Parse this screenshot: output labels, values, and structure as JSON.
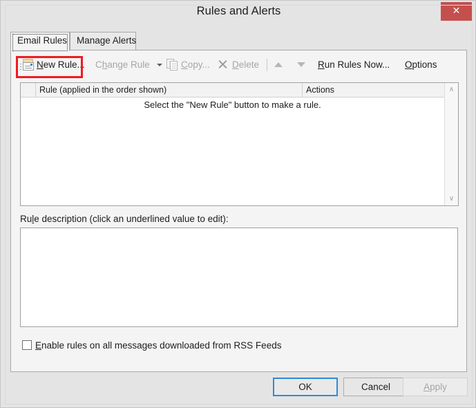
{
  "window": {
    "title": "Rules and Alerts",
    "close_icon": "close-icon",
    "close_glyph": "✕",
    "accent_close_bg": "#c4504e"
  },
  "tabs": [
    {
      "label": "Email Rules",
      "active": true
    },
    {
      "label": "Manage Alerts",
      "active": false
    }
  ],
  "toolbar": {
    "new_rule": {
      "label_pre": "",
      "accel": "N",
      "label_post": "ew Rule...",
      "icon": "new-rule-icon",
      "enabled": true,
      "highlight_color": "#ed1c24"
    },
    "change_rule": {
      "label_pre": "C",
      "accel": "h",
      "label_post": "ange Rule",
      "icon": "chevron-down-icon",
      "enabled": false
    },
    "copy": {
      "label_pre": "",
      "accel": "C",
      "label_post": "opy...",
      "icon": "copy-icon",
      "enabled": false
    },
    "delete": {
      "label_pre": "",
      "accel": "D",
      "label_post": "elete",
      "icon": "delete-x-icon",
      "enabled": false
    },
    "move_up": {
      "icon": "arrow-up-icon",
      "enabled": false
    },
    "move_down": {
      "icon": "arrow-down-icon",
      "enabled": false
    },
    "run_rules_now": {
      "label_pre": "",
      "accel": "R",
      "label_post": "un Rules Now...",
      "enabled": true
    },
    "options": {
      "label_pre": "",
      "accel": "O",
      "label_post": "ptions",
      "enabled": true
    }
  },
  "rules_list": {
    "columns": [
      "",
      "Rule (applied in the order shown)",
      "Actions"
    ],
    "rows": [],
    "empty_message": "Select the \"New Rule\" button to make a rule.",
    "scrollbar": {
      "up_glyph": "∧",
      "down_glyph": "∨"
    }
  },
  "description": {
    "label_pre": "Ru",
    "label_accel": "l",
    "label_post": "e description (click an underlined value to edit):",
    "value": ""
  },
  "rss_checkbox": {
    "checked": false,
    "label_accel": "E",
    "label_post": "nable rules on all messages downloaded from RSS Feeds"
  },
  "footer": {
    "ok": {
      "label": "OK",
      "default": true
    },
    "cancel": {
      "label": "Cancel"
    },
    "apply": {
      "label_accel": "A",
      "label_post": "pply",
      "enabled": false
    }
  }
}
